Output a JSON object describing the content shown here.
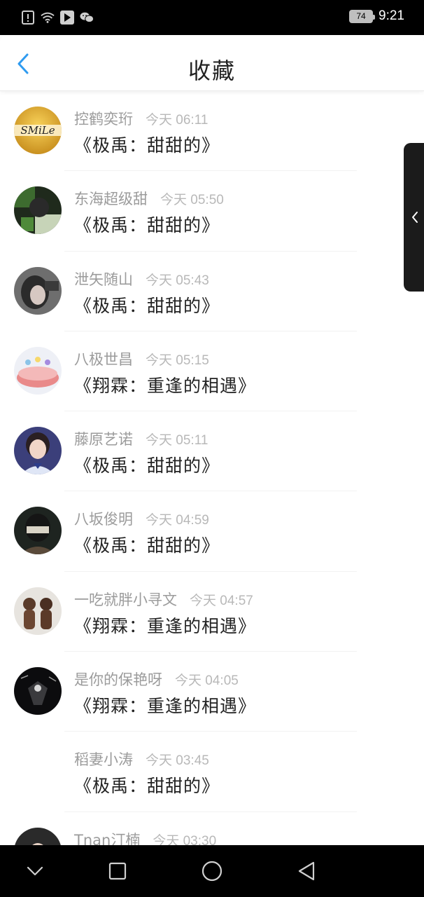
{
  "status_bar": {
    "battery": "74",
    "time": "9:21",
    "icons": [
      "alert-icon",
      "wifi-icon",
      "media-play-icon",
      "wechat-icon"
    ]
  },
  "header": {
    "title": "收藏",
    "back_icon": "chevron-left-icon"
  },
  "accent_color": "#2f9bf0",
  "favorites": [
    {
      "user": "控鹤奕珩",
      "time": "今天 06:11",
      "title": "《极禹：甜甜的》",
      "avatar": "smile-avatar"
    },
    {
      "user": "东海超级甜",
      "time": "今天 05:50",
      "title": "《极禹：甜甜的》",
      "avatar": "green-photo-avatar"
    },
    {
      "user": "泄矢随山",
      "time": "今天 05:43",
      "title": "《极禹：甜甜的》",
      "avatar": "dark-photo-avatar"
    },
    {
      "user": "八极世昌",
      "time": "今天 05:15",
      "title": "《翔霖：重逢的相遇》",
      "avatar": "cake-avatar"
    },
    {
      "user": "藤原艺诺",
      "time": "今天 05:11",
      "title": "《极禹：甜甜的》",
      "avatar": "boy-portrait-avatar"
    },
    {
      "user": "八坂俊明",
      "time": "今天 04:59",
      "title": "《极禹：甜甜的》",
      "avatar": "masked-portrait-avatar"
    },
    {
      "user": "一吃就胖小寻文",
      "time": "今天 04:57",
      "title": "《翔霖：重逢的相遇》",
      "avatar": "figurine-avatar"
    },
    {
      "user": "是你的保艳呀",
      "time": "今天 04:05",
      "title": "《翔霖：重逢的相遇》",
      "avatar": "night-avatar"
    },
    {
      "user": "稻妻小涛",
      "time": "今天 03:45",
      "title": "《极禹：甜甜的》",
      "avatar": ""
    },
    {
      "user": "Tnan汀楠",
      "time": "今天 03:30",
      "title": "",
      "avatar": "partial-avatar"
    }
  ],
  "side_handle_icon": "chevron-left-icon",
  "nav_bar": {
    "icons": [
      "chevron-down-icon",
      "square-recents-icon",
      "circle-home-icon",
      "triangle-back-icon"
    ]
  }
}
